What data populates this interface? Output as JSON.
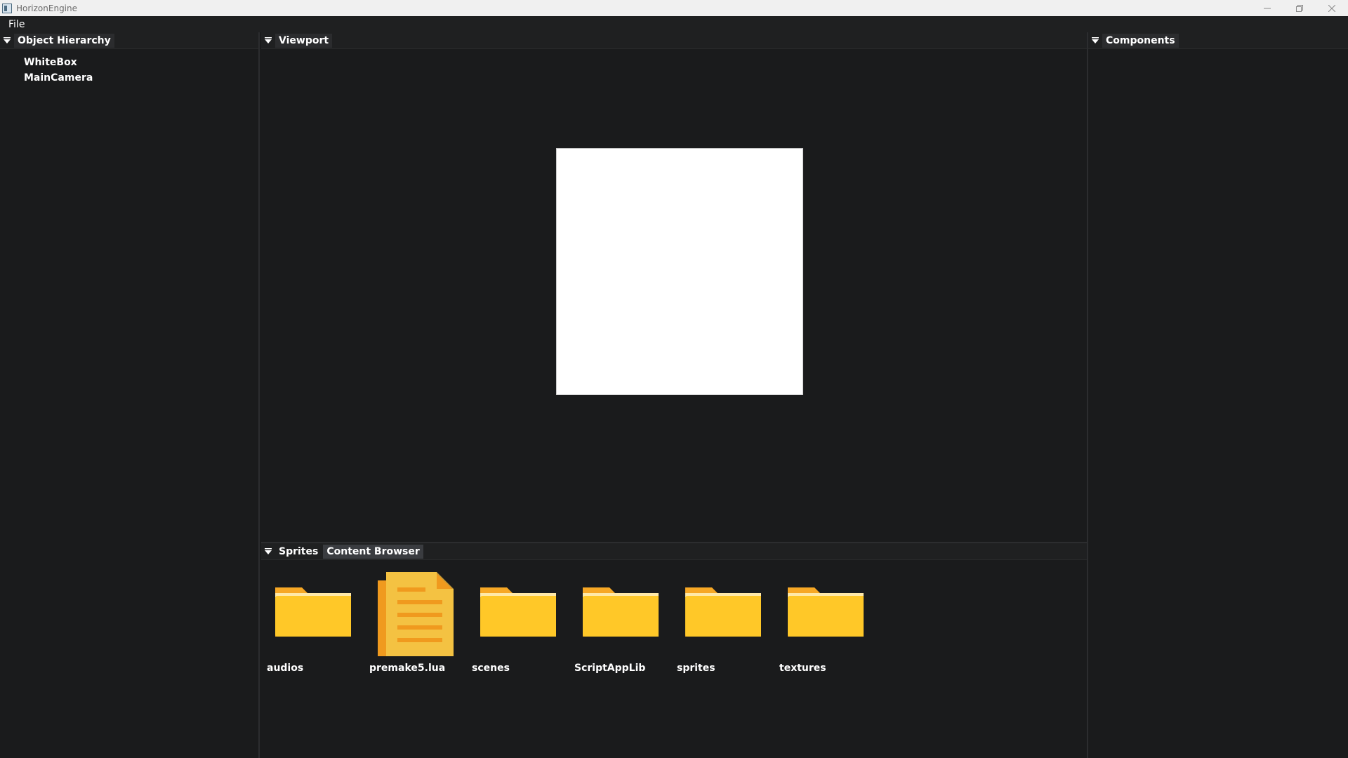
{
  "window": {
    "title": "HorizonEngine"
  },
  "menu": {
    "file_label": "File"
  },
  "hierarchy": {
    "tab_label": "Object Hierarchy",
    "items": [
      {
        "label": "WhiteBox"
      },
      {
        "label": "MainCamera"
      }
    ]
  },
  "viewport": {
    "tab_label": "Viewport",
    "object_color": "#ffffff"
  },
  "components": {
    "tab_label": "Components"
  },
  "content_browser": {
    "tabs": [
      {
        "label": "Sprites"
      },
      {
        "label": "Content Browser"
      }
    ],
    "items": [
      {
        "label": "audios",
        "icon": "folder-icon"
      },
      {
        "label": "premake5.lua",
        "icon": "file-icon"
      },
      {
        "label": "scenes",
        "icon": "folder-icon"
      },
      {
        "label": "ScriptAppLib",
        "icon": "folder-icon"
      },
      {
        "label": "sprites",
        "icon": "folder-icon"
      },
      {
        "label": "textures",
        "icon": "folder-icon"
      }
    ]
  },
  "colors": {
    "folder": "#ffc828",
    "folder_tab": "#f7a825",
    "file": "#f4c242",
    "file_back": "#f09a1e",
    "background": "#1a1b1c"
  }
}
